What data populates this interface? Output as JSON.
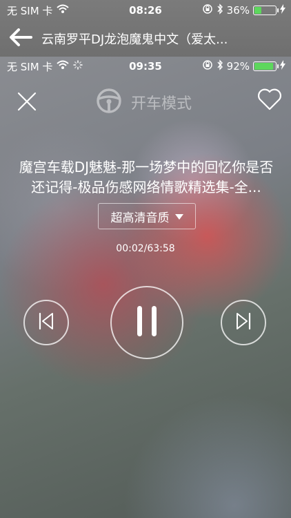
{
  "outer_status": {
    "carrier": "无 SIM 卡",
    "time": "08:26",
    "battery_percent": "36%",
    "battery_level": 0.36
  },
  "nav": {
    "back_icon": "back-arrow-icon",
    "title": "云南罗平DJ龙泡魔鬼中文（爱太..."
  },
  "player_status": {
    "carrier": "无 SIM 卡",
    "time": "09:35",
    "battery_percent": "92%",
    "battery_level": 0.92
  },
  "top_bar": {
    "close_icon": "close-icon",
    "drive_icon": "steering-wheel-icon",
    "drive_label": "开车模式",
    "favorite_icon": "heart-icon"
  },
  "song": {
    "title": "魔宫车载DJ魅魅-那一场梦中的回忆你是否还记得-极品伤感网络情歌精选集-全..."
  },
  "quality": {
    "selected": "超高清音质"
  },
  "progress": {
    "readout": "00:02/63:58"
  },
  "colors": {
    "battery_fill": "#5dd75d"
  }
}
